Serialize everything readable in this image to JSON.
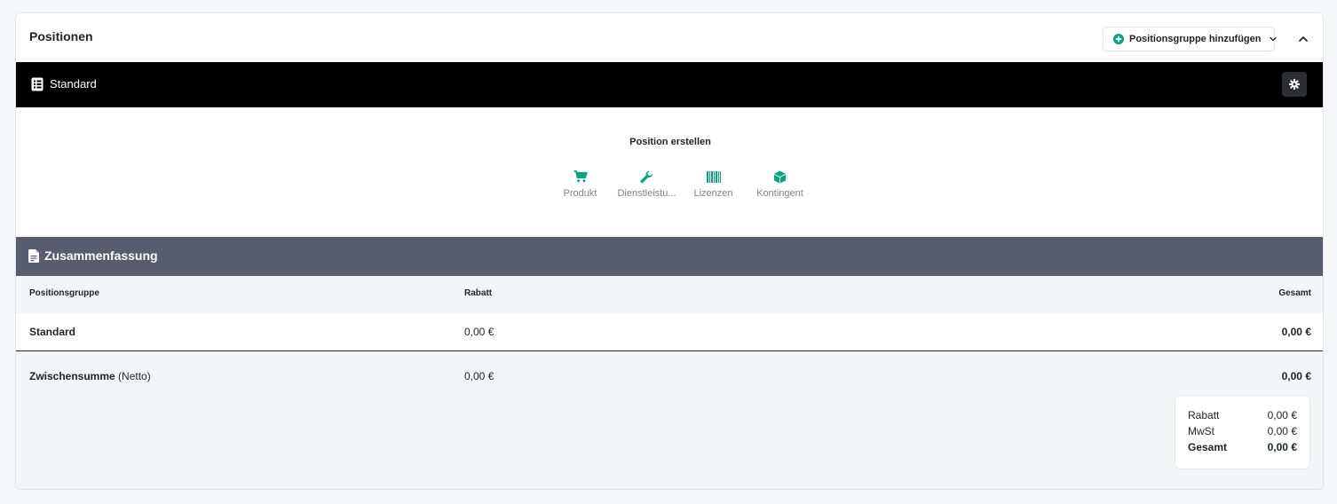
{
  "header": {
    "title": "Positionen",
    "add_group_label": "Positionsgruppe hinzufügen"
  },
  "group": {
    "name": "Standard"
  },
  "create": {
    "title": "Position erstellen",
    "options": [
      {
        "label": "Produkt",
        "icon": "cart-icon"
      },
      {
        "label": "Dienstleistu...",
        "icon": "wrench-icon"
      },
      {
        "label": "Lizenzen",
        "icon": "barcode-icon"
      },
      {
        "label": "Kontingent",
        "icon": "box-icon"
      }
    ]
  },
  "summary": {
    "title": "Zusammenfassung",
    "columns": {
      "group": "Positionsgruppe",
      "discount": "Rabatt",
      "total": "Gesamt"
    },
    "rows": [
      {
        "group": "Standard",
        "discount": "0,00 €",
        "total": "0,00 €"
      }
    ],
    "subtotal": {
      "label": "Zwischensumme",
      "suffix": "(Netto)",
      "discount": "0,00 €",
      "total": "0,00 €"
    },
    "totals": {
      "discount_label": "Rabatt",
      "discount_value": "0,00 €",
      "tax_label": "MwSt",
      "tax_value": "0,00 €",
      "total_label": "Gesamt",
      "total_value": "0,00 €"
    }
  },
  "colors": {
    "accent": "#0aa37f",
    "group_bar": "#000000",
    "summary_bar": "#575d6d",
    "muted_bg": "#f4f5f8"
  }
}
